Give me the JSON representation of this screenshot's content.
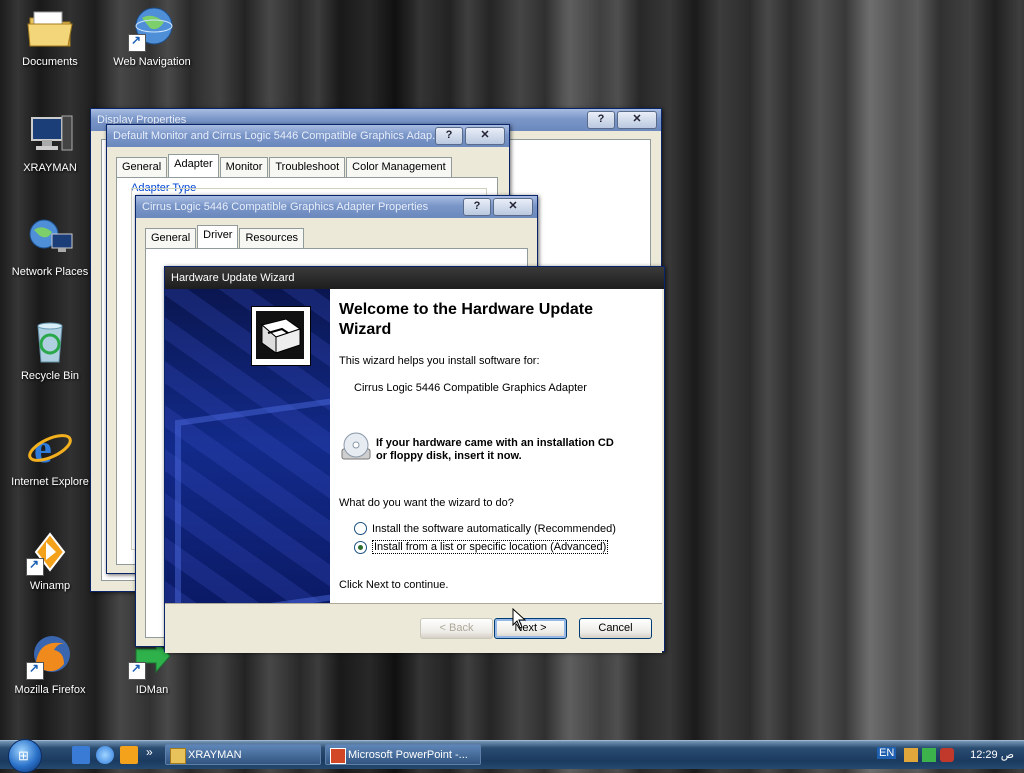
{
  "desktop_icons": [
    {
      "label": "Documents",
      "icon": "folder-icon"
    },
    {
      "label": "Web Navigation",
      "icon": "globe-icon"
    },
    {
      "label": "XRAYMAN",
      "icon": "computer-icon"
    },
    {
      "label": "Network Places",
      "icon": "network-icon"
    },
    {
      "label": "Recycle Bin",
      "icon": "recycle-bin-icon"
    },
    {
      "label": "Internet Explore",
      "icon": "ie-icon"
    },
    {
      "label": "Winamp",
      "icon": "winamp-icon"
    },
    {
      "label": "Mozilla Firefox",
      "icon": "firefox-icon"
    },
    {
      "label": "IDMan",
      "icon": "idman-icon"
    }
  ],
  "display_properties": {
    "title": "Display Properties",
    "help": "?",
    "close": "✕"
  },
  "monitor_dialog": {
    "title": "Default Monitor and Cirrus Logic 5446 Compatible Graphics Adap...",
    "help": "?",
    "close": "✕",
    "tabs": [
      "General",
      "Adapter",
      "Monitor",
      "Troubleshoot",
      "Color Management"
    ],
    "active_tab": "Adapter",
    "group_label": "Adapter Type"
  },
  "adapter_dialog": {
    "title": "Cirrus Logic 5446 Compatible Graphics Adapter Properties",
    "help": "?",
    "close": "✕",
    "tabs": [
      "General",
      "Driver",
      "Resources"
    ],
    "active_tab": "Driver"
  },
  "wizard": {
    "title": "Hardware Update Wizard",
    "heading": "Welcome to the Hardware Update Wizard",
    "intro": "This wizard helps you install software for:",
    "device": "Cirrus Logic 5446 Compatible Graphics Adapter",
    "cd_hint_line1": "If your hardware came with an installation CD",
    "cd_hint_line2": "or floppy disk, insert it now.",
    "question": "What do you want the wizard to do?",
    "options": [
      {
        "label": "Install the software automatically (Recommended)",
        "selected": false
      },
      {
        "label": "Install from a list or specific location (Advanced)",
        "selected": true
      }
    ],
    "continue_hint": "Click Next to continue.",
    "back_label": "< Back",
    "next_label": "Next >",
    "cancel_label": "Cancel"
  },
  "taskbar": {
    "tasks": [
      {
        "label": "XRAYMAN",
        "icon": "folder-icon"
      },
      {
        "label": "Microsoft PowerPoint -...",
        "icon": "powerpoint-icon"
      }
    ],
    "language": "EN",
    "clock": "12:29 ص"
  },
  "colors": {
    "titlebar_active": "#2b5aa4",
    "wizard_banner": "#122a8a",
    "dialog_face": "#ece9d8"
  }
}
